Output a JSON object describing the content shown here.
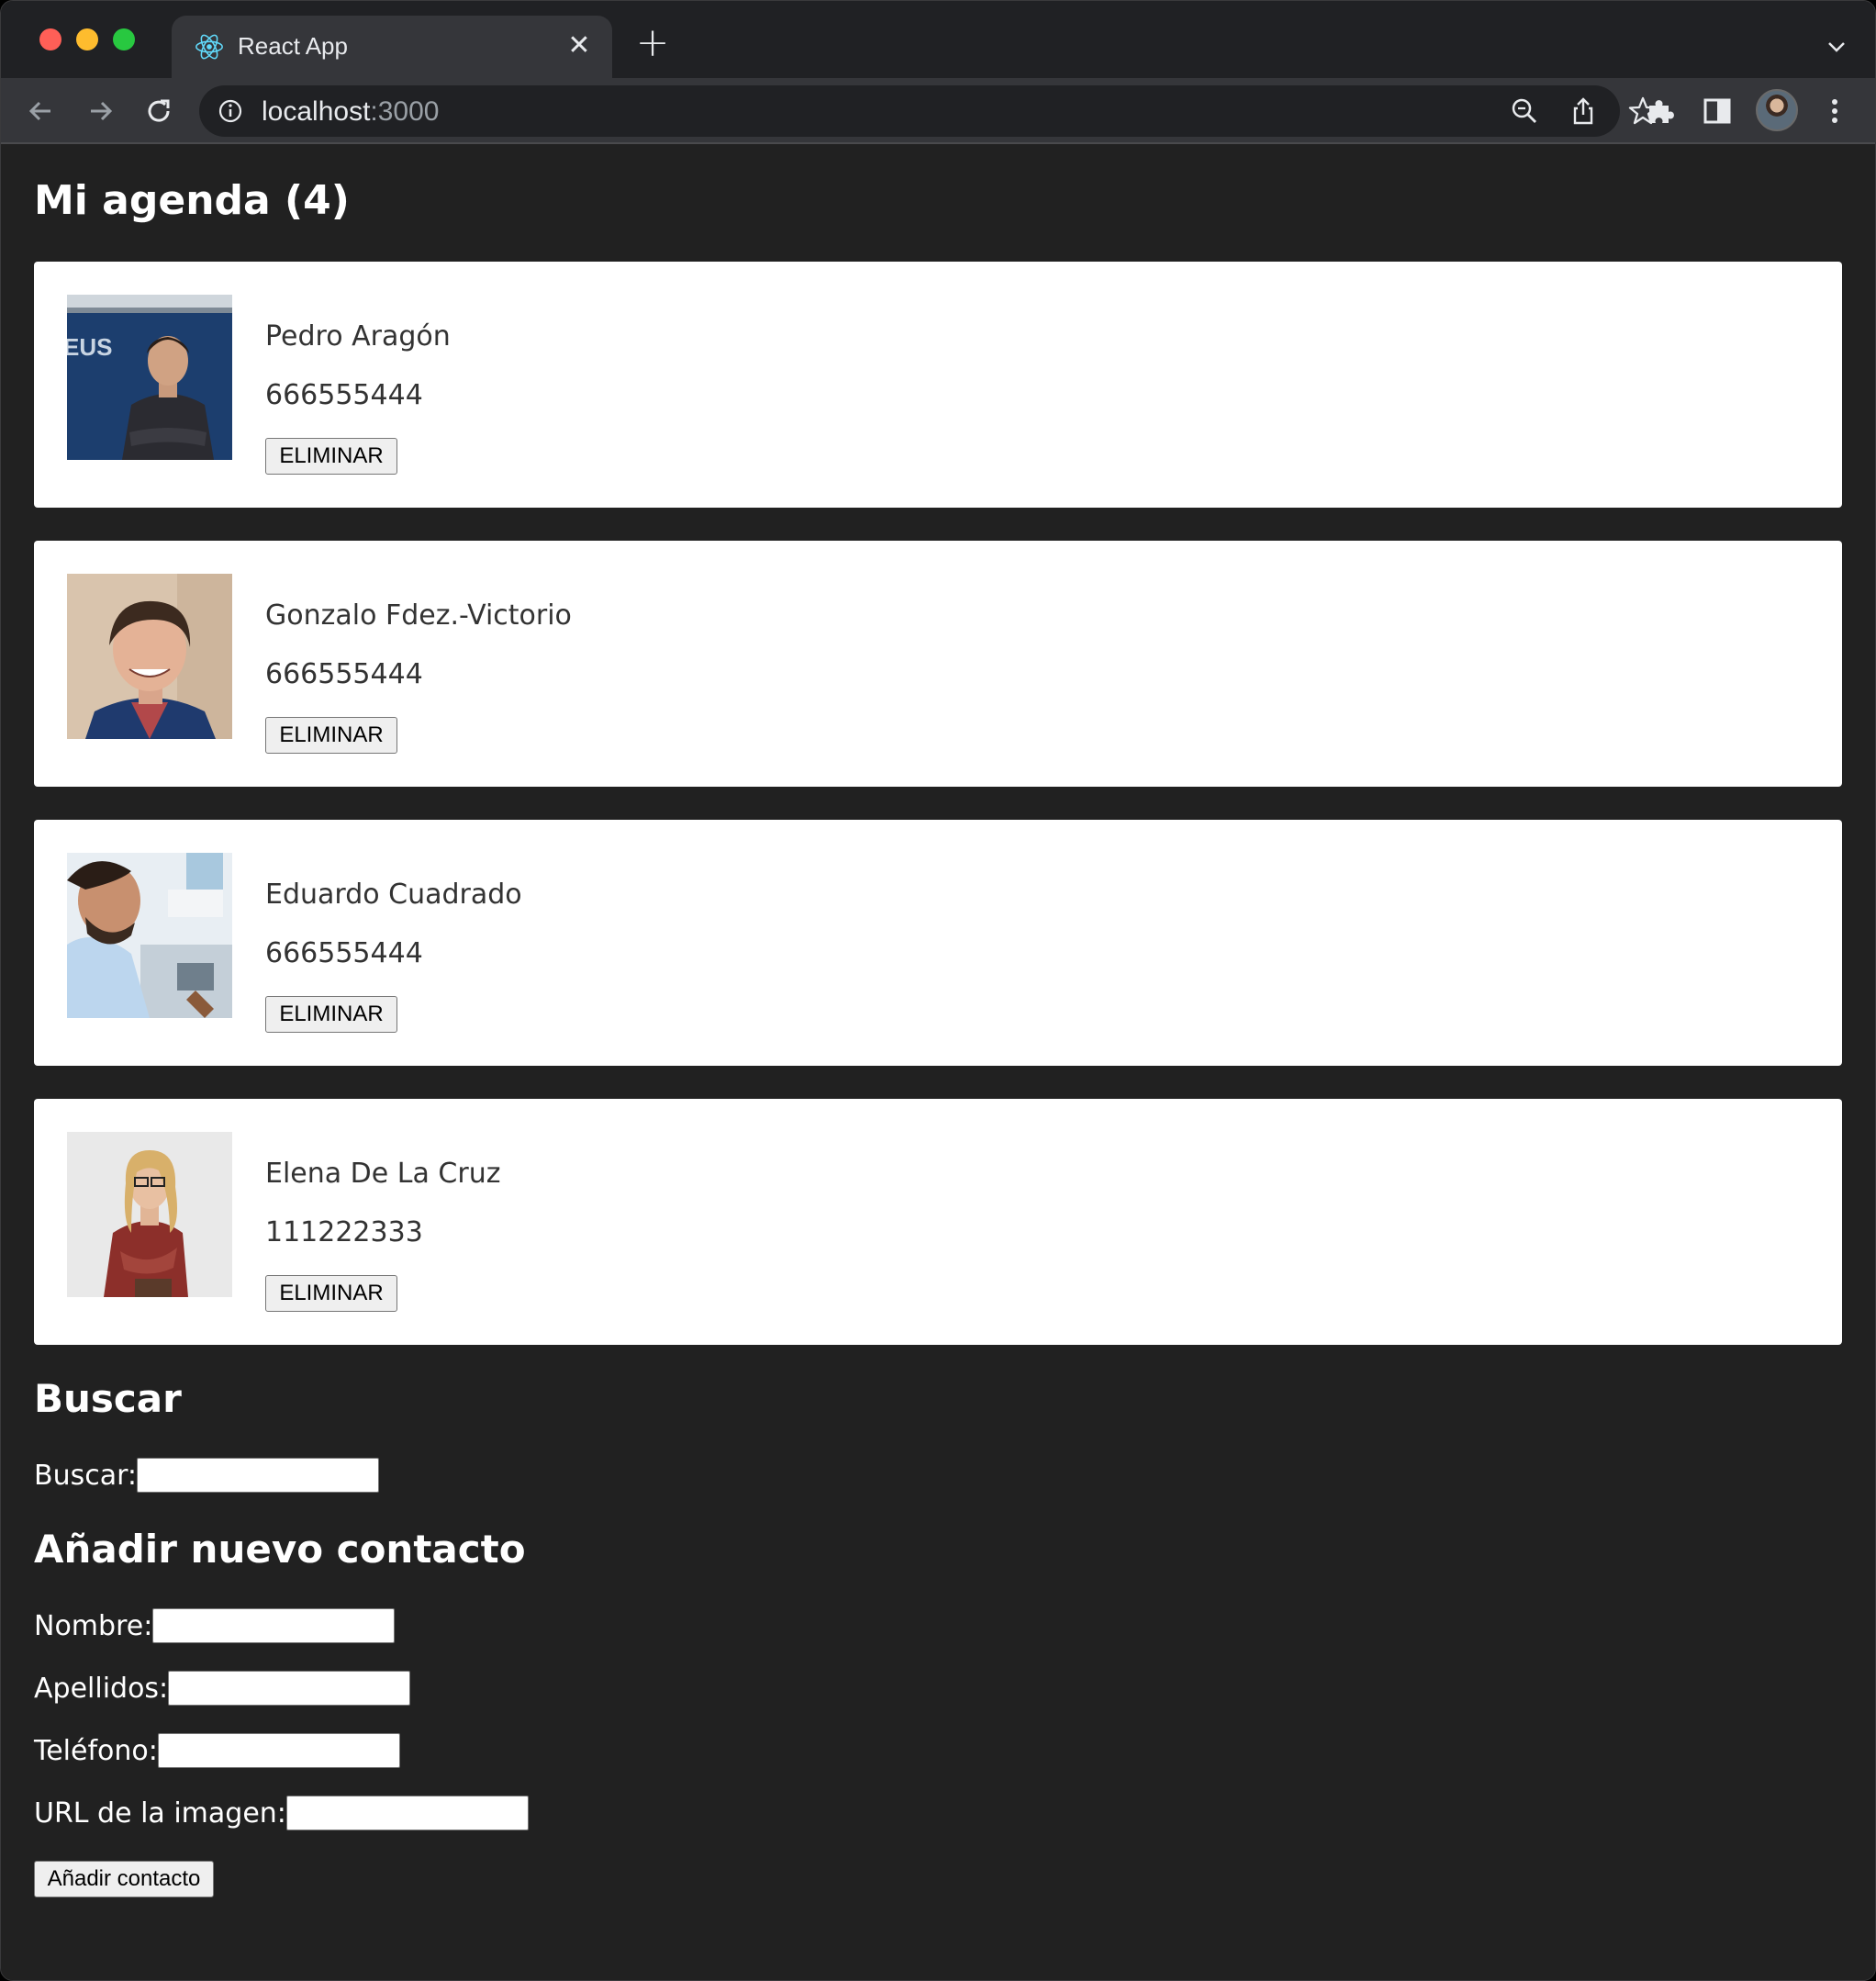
{
  "browser": {
    "tab_title": "React App",
    "url_host": "localhost",
    "url_port": ":3000"
  },
  "page": {
    "title": "Mi agenda (4)",
    "contacts": [
      {
        "name": "Pedro Aragón",
        "phone": "666555444",
        "delete_label": "ELIMINAR"
      },
      {
        "name": "Gonzalo Fdez.-Victorio",
        "phone": "666555444",
        "delete_label": "ELIMINAR"
      },
      {
        "name": "Eduardo Cuadrado",
        "phone": "666555444",
        "delete_label": "ELIMINAR"
      },
      {
        "name": "Elena De La Cruz",
        "phone": "111222333",
        "delete_label": "ELIMINAR"
      }
    ],
    "search": {
      "heading": "Buscar",
      "label": "Buscar:",
      "value": ""
    },
    "add_form": {
      "heading": "Añadir nuevo contacto",
      "nombre_label": "Nombre:",
      "apellidos_label": "Apellidos:",
      "telefono_label": "Teléfono:",
      "url_label": "URL de la imagen:",
      "submit_label": "Añadir contacto"
    }
  }
}
